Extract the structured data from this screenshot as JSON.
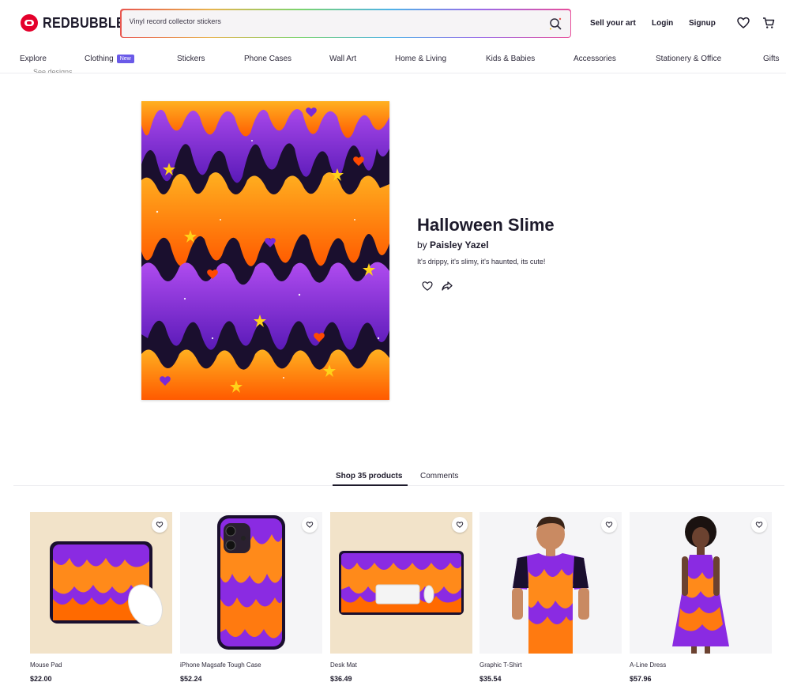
{
  "header": {
    "logo_text": "REDBUBBLE",
    "search": {
      "value": "Vinyl record collector stickers"
    },
    "links": {
      "sell": "Sell your art",
      "login": "Login",
      "signup": "Signup"
    }
  },
  "nav": {
    "items": [
      {
        "label": "Explore"
      },
      {
        "label": "Clothing",
        "badge": "New"
      },
      {
        "label": "Stickers"
      },
      {
        "label": "Phone Cases"
      },
      {
        "label": "Wall Art"
      },
      {
        "label": "Home & Living"
      },
      {
        "label": "Kids & Babies"
      },
      {
        "label": "Accessories"
      },
      {
        "label": "Stationery & Office"
      },
      {
        "label": "Gifts"
      }
    ]
  },
  "breadcrumb": {
    "cut_text": "See designs"
  },
  "design": {
    "title": "Halloween Slime",
    "by_prefix": "by",
    "artist": "Paisley Yazel",
    "description": "It's drippy, it's slimy, it's haunted, its cute!"
  },
  "tabs": {
    "products": "Shop 35 products",
    "comments": "Comments"
  },
  "products": [
    {
      "name": "Mouse Pad",
      "price": "$22.00"
    },
    {
      "name": "iPhone Magsafe Tough Case",
      "price": "$52.24"
    },
    {
      "name": "Desk Mat",
      "price": "$36.49"
    },
    {
      "name": "Graphic T-Shirt",
      "price": "$35.54"
    },
    {
      "name": "A-Line Dress",
      "price": "$57.96"
    }
  ],
  "colors": {
    "brand_red": "#e4002b",
    "slime_purple": "#8a2be2",
    "slime_orange": "#ff8a1a",
    "slime_dark": "#1a0f2e",
    "badge_purple": "#6a5ae8"
  }
}
